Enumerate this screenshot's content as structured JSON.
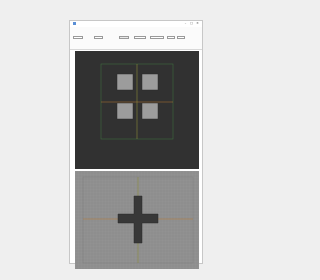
{
  "window": {
    "title": "",
    "minimize_glyph": "–",
    "maximize_glyph": "□",
    "close_glyph": "✕"
  },
  "toolbar": {
    "label_a": "",
    "value_a": "",
    "label_b": "",
    "value_b": "",
    "button_label": "",
    "select_value": "",
    "label_c": "",
    "label_d": ""
  },
  "icons": {
    "app": "app-icon",
    "minimize": "minimize-icon",
    "maximize": "maximize-icon",
    "close": "close-icon"
  },
  "colors": {
    "top_view_bg": "#313131",
    "bottom_view_bg": "#8e8e8e",
    "square_fill": "#9c9c9c",
    "cross_fill": "#383838",
    "axis_h": "#b8792e",
    "axis_v": "#8a8a3a",
    "guide": "#3f6a3f"
  }
}
